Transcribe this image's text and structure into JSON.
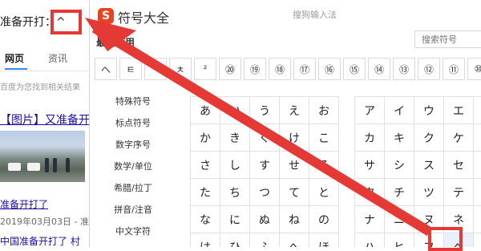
{
  "background_page": {
    "search_query": "准备开打：^",
    "tabs": [
      "网页",
      "资讯"
    ],
    "hint": "百度为您找到相关结果",
    "result_title": "【图片】又准备开",
    "result_link": "准备开打了",
    "result_date": "2019年03月03日 - 准",
    "result_link2": "中国准备开打了 村"
  },
  "ime_window": {
    "logo": "S",
    "title": "符号大全",
    "subtitle": "搜狗输入法",
    "recent_label": "最近使用",
    "search_placeholder": "搜索符号",
    "recent_symbols": [
      "へ",
      "ㅌ",
      "ㄱ",
      "ㅊ",
      "²",
      "⑳",
      "⑲",
      "⑱",
      "⑰",
      "⑯",
      "⑮",
      "⑭",
      "⑬",
      "⑫",
      "⑪",
      "⑩"
    ],
    "categories": [
      "特殊符号",
      "标点符号",
      "数字序号",
      "数学/单位",
      "希腊/拉丁",
      "拼音/注音",
      "中文字符"
    ],
    "hiragana_rows": [
      [
        "あ",
        "い",
        "う",
        "え",
        "お"
      ],
      [
        "か",
        "き",
        "く",
        "け",
        "こ"
      ],
      [
        "さ",
        "し",
        "す",
        "せ",
        "そ"
      ],
      [
        "た",
        "ち",
        "つ",
        "て",
        "と"
      ],
      [
        "な",
        "に",
        "ぬ",
        "ね",
        "の"
      ],
      [
        "は",
        "ひ",
        "ふ",
        "へ",
        "ほ"
      ]
    ],
    "katakana_rows": [
      [
        "ア",
        "イ",
        "ウ",
        "エ",
        "オ"
      ],
      [
        "カ",
        "キ",
        "ク",
        "ケ",
        "コ"
      ],
      [
        "サ",
        "シ",
        "ス",
        "セ",
        "ソ"
      ],
      [
        "タ",
        "チ",
        "ツ",
        "テ",
        "ト"
      ],
      [
        "ナ",
        "ニ",
        "ヌ",
        "ネ",
        "ノ"
      ],
      [
        "ハ",
        "ヒ",
        "フ",
        "ヘ",
        "ホ"
      ]
    ],
    "selected_symbol": "ヘ"
  },
  "colors": {
    "annotation_red": "#e53935",
    "logo_orange": "#e8441f",
    "link_blue": "#1a0dab",
    "tab_blue": "#3388ff"
  }
}
